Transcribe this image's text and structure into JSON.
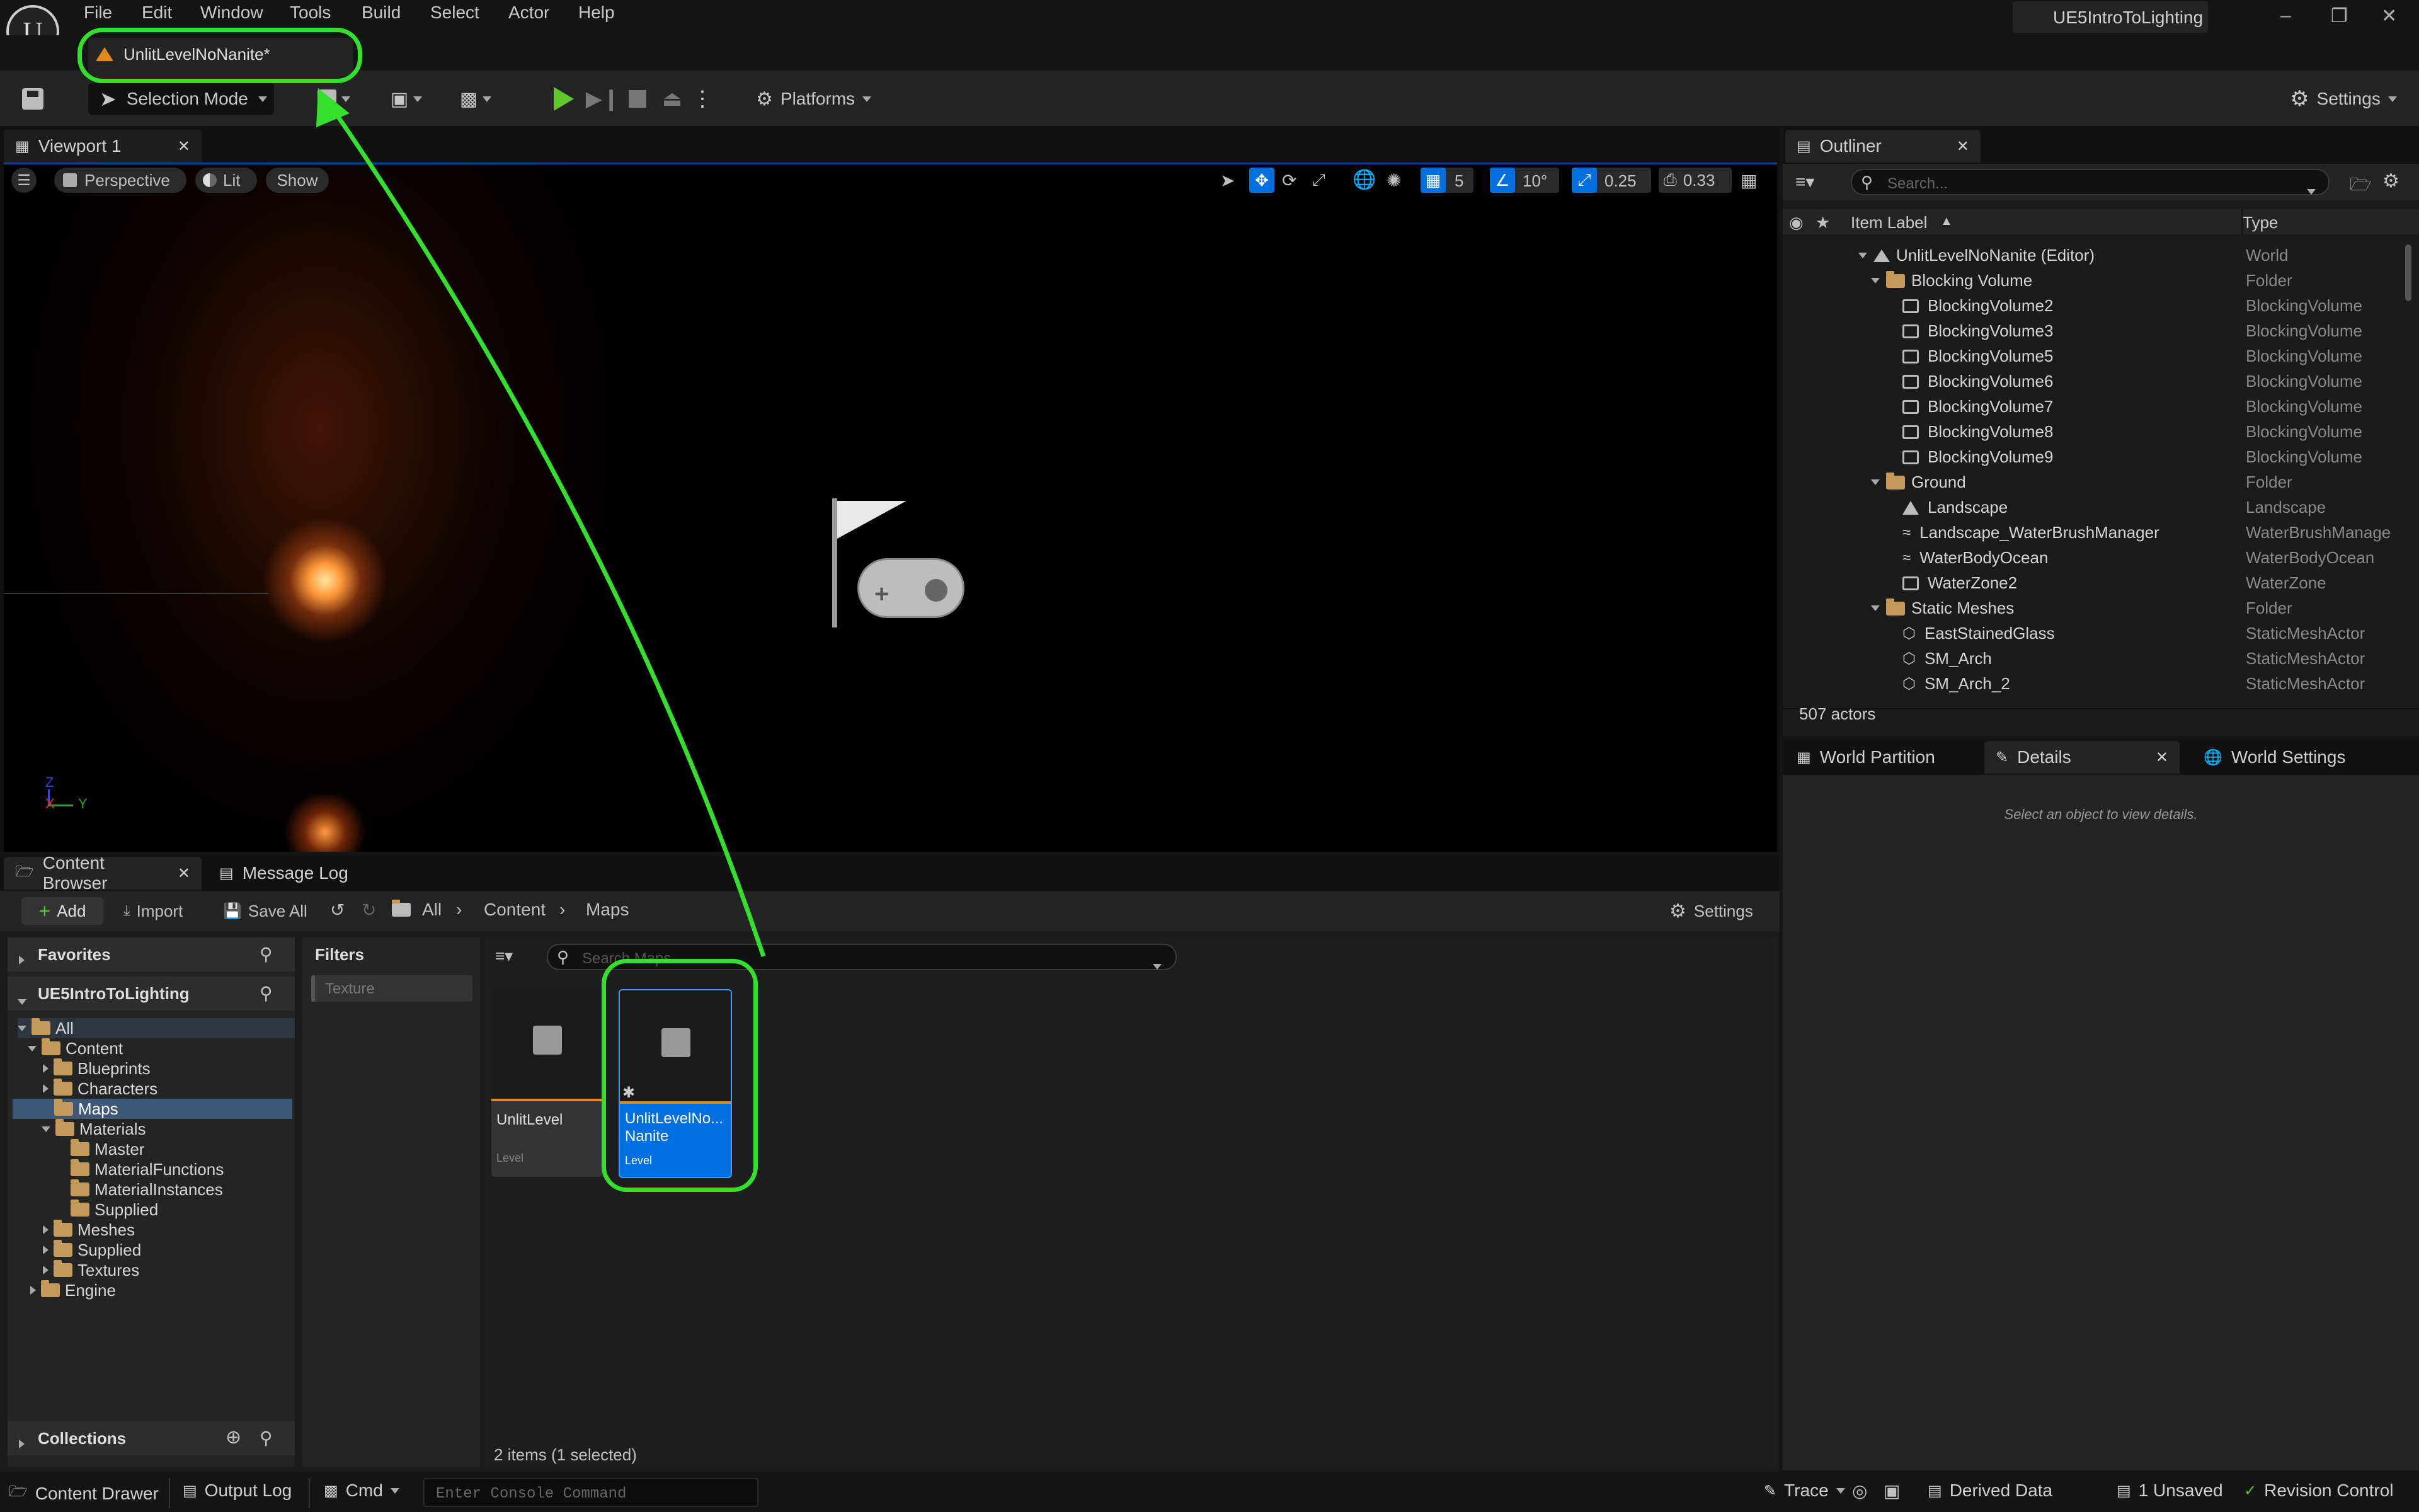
{
  "menu": {
    "items": [
      "File",
      "Edit",
      "Window",
      "Tools",
      "Build",
      "Select",
      "Actor",
      "Help"
    ],
    "project": "UE5IntroToLighting"
  },
  "level_tab": {
    "label": "UnlitLevelNoNanite*"
  },
  "toolbar": {
    "selection_mode": "Selection Mode",
    "platforms": "Platforms",
    "settings": "Settings"
  },
  "viewport": {
    "tab_label": "Viewport 1",
    "perspective": "Perspective",
    "lit": "Lit",
    "show": "Show",
    "grid_value": "5",
    "angle_value": "10°",
    "scale_value": "0.25",
    "camera_speed": "0.33",
    "axis_z": "Z",
    "axis_x": "X",
    "axis_y": "Y"
  },
  "outliner": {
    "tab_label": "Outliner",
    "search_placeholder": "Search...",
    "col_label": "Item Label",
    "col_type": "Type",
    "rows": [
      {
        "label": "UnlitLevelNoNanite (Editor)",
        "type": "World"
      },
      {
        "label": "Blocking Volume",
        "type": "Folder"
      },
      {
        "label": "BlockingVolume2",
        "type": "BlockingVolume"
      },
      {
        "label": "BlockingVolume3",
        "type": "BlockingVolume"
      },
      {
        "label": "BlockingVolume5",
        "type": "BlockingVolume"
      },
      {
        "label": "BlockingVolume6",
        "type": "BlockingVolume"
      },
      {
        "label": "BlockingVolume7",
        "type": "BlockingVolume"
      },
      {
        "label": "BlockingVolume8",
        "type": "BlockingVolume"
      },
      {
        "label": "BlockingVolume9",
        "type": "BlockingVolume"
      },
      {
        "label": "Ground",
        "type": "Folder"
      },
      {
        "label": "Landscape",
        "type": "Landscape"
      },
      {
        "label": "Landscape_WaterBrushManager",
        "type": "WaterBrushManage"
      },
      {
        "label": "WaterBodyOcean",
        "type": "WaterBodyOcean"
      },
      {
        "label": "WaterZone2",
        "type": "WaterZone"
      },
      {
        "label": "Static Meshes",
        "type": "Folder"
      },
      {
        "label": "EastStainedGlass",
        "type": "StaticMeshActor"
      },
      {
        "label": "SM_Arch",
        "type": "StaticMeshActor"
      },
      {
        "label": "SM_Arch_2",
        "type": "StaticMeshActor"
      }
    ],
    "actor_count": "507 actors"
  },
  "details": {
    "tabs": [
      "World Partition",
      "Details",
      "World Settings"
    ],
    "empty_text": "Select an object to view details."
  },
  "content_browser": {
    "tab_label": "Content Browser",
    "message_log": "Message Log",
    "add": "Add",
    "import": "Import",
    "save_all": "Save All",
    "breadcrumb": [
      "All",
      "Content",
      "Maps"
    ],
    "settings": "Settings",
    "favorites": "Favorites",
    "project": "UE5IntroToLighting",
    "filters": "Filters",
    "filter_chip": "Texture",
    "search_placeholder": "Search Maps",
    "tree": [
      "All",
      "Content",
      "Blueprints",
      "Characters",
      "Maps",
      "Materials",
      "Master",
      "MaterialFunctions",
      "MaterialInstances",
      "Supplied",
      "Meshes",
      "Supplied",
      "Textures",
      "Engine"
    ],
    "assets": [
      {
        "name": "UnlitLevel",
        "type": "Level"
      },
      {
        "name": "UnlitLevelNo... Nanite",
        "name_line1": "UnlitLevelNo...",
        "name_line2": "Nanite",
        "type": "Level"
      }
    ],
    "count": "2 items (1 selected)",
    "collections": "Collections"
  },
  "statusbar": {
    "content_drawer": "Content Drawer",
    "output_log": "Output Log",
    "cmd": "Cmd",
    "console_placeholder": "Enter Console Command",
    "trace": "Trace",
    "derived_data": "Derived Data",
    "unsaved": "1 Unsaved",
    "revision_control": "Revision Control"
  },
  "colors": {
    "accent": "#0070e0",
    "highlight": "#33e02b",
    "folder": "#c39a5a"
  }
}
